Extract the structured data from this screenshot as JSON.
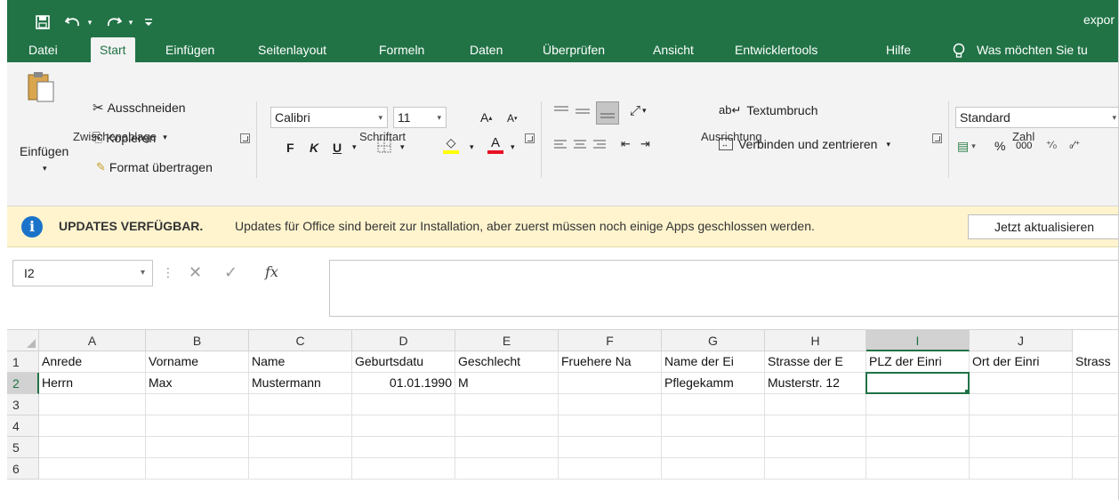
{
  "window": {
    "title": "expor"
  },
  "tabs": [
    {
      "label": "Datei"
    },
    {
      "label": "Start"
    },
    {
      "label": "Einfügen"
    },
    {
      "label": "Seitenlayout"
    },
    {
      "label": "Formeln"
    },
    {
      "label": "Daten"
    },
    {
      "label": "Überprüfen"
    },
    {
      "label": "Ansicht"
    },
    {
      "label": "Entwicklertools"
    },
    {
      "label": "Hilfe"
    }
  ],
  "tell_me": "Was möchten Sie tu",
  "ribbon": {
    "clipboard": {
      "paste": "Einfügen",
      "cut": "Ausschneiden",
      "copy": "Kopieren",
      "format_painter": "Format übertragen",
      "group": "Zwischenablage"
    },
    "font": {
      "name": "Calibri",
      "size": "11",
      "bold": "F",
      "italic": "K",
      "underline": "U",
      "group": "Schriftart"
    },
    "alignment": {
      "wrap": "Textumbruch",
      "merge": "Verbinden und zentrieren",
      "group": "Ausrichtung"
    },
    "number": {
      "format": "Standard",
      "percent": "%",
      "thousands": "000",
      "group": "Zahl"
    }
  },
  "update_bar": {
    "title": "UPDATES VERFÜGBAR.",
    "message": "Updates für Office sind bereit zur Installation, aber zuerst müssen noch einige Apps geschlossen werden.",
    "button": "Jetzt aktualisieren"
  },
  "formula_bar": {
    "name_box": "I2",
    "fx": "fx",
    "value": ""
  },
  "sheet": {
    "columns": [
      "A",
      "B",
      "C",
      "D",
      "E",
      "F",
      "G",
      "H",
      "I",
      "J"
    ],
    "selected_column": "I",
    "rows": [
      "1",
      "2",
      "3",
      "4",
      "5",
      "6"
    ],
    "selected_row": "2",
    "active_cell": "I2",
    "cells": [
      [
        "Anrede",
        "Vorname",
        "Name",
        "Geburtsdatu",
        "Geschlecht",
        "Fruehere Na",
        "Name der Ei",
        "Strasse der E",
        "PLZ der Einri",
        "Ort der Einri",
        "Strass"
      ],
      [
        "Herrn",
        "Max",
        "Mustermann",
        "01.01.1990",
        "M",
        "",
        "Pflegekamm",
        "Musterstr. 12",
        "",
        "",
        ""
      ]
    ]
  }
}
